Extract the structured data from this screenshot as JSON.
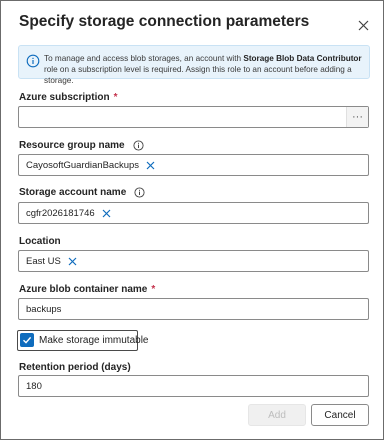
{
  "dialog": {
    "title": "Specify storage connection parameters",
    "close_icon": "close-icon"
  },
  "info": {
    "icon": "info-icon",
    "text_before": "To manage and access blob storages, an account with ",
    "text_bold": "Storage Blob Data Contributor",
    "text_after": " role on a subscription level is required. Assign this role to an account before adding a storage."
  },
  "fields": {
    "subscription": {
      "label": "Azure subscription",
      "required_mark": "*",
      "value": "",
      "browse_label": "···"
    },
    "resource_group": {
      "label": "Resource group name",
      "value": "CayosoftGuardianBackups"
    },
    "storage_account": {
      "label": "Storage account name",
      "value": "cgfr2026181746"
    },
    "location": {
      "label": "Location",
      "value": "East US"
    },
    "container": {
      "label": "Azure blob container name",
      "required_mark": "*",
      "value": "backups"
    },
    "immutable": {
      "label": "Make storage immutable",
      "checked": true
    },
    "retention": {
      "label": "Retention period (days)",
      "value": "180"
    }
  },
  "buttons": {
    "add": "Add",
    "cancel": "Cancel"
  },
  "colors": {
    "accent": "#0f6cbd",
    "required": "#c4314b",
    "info_bg": "#e8f3fb"
  }
}
